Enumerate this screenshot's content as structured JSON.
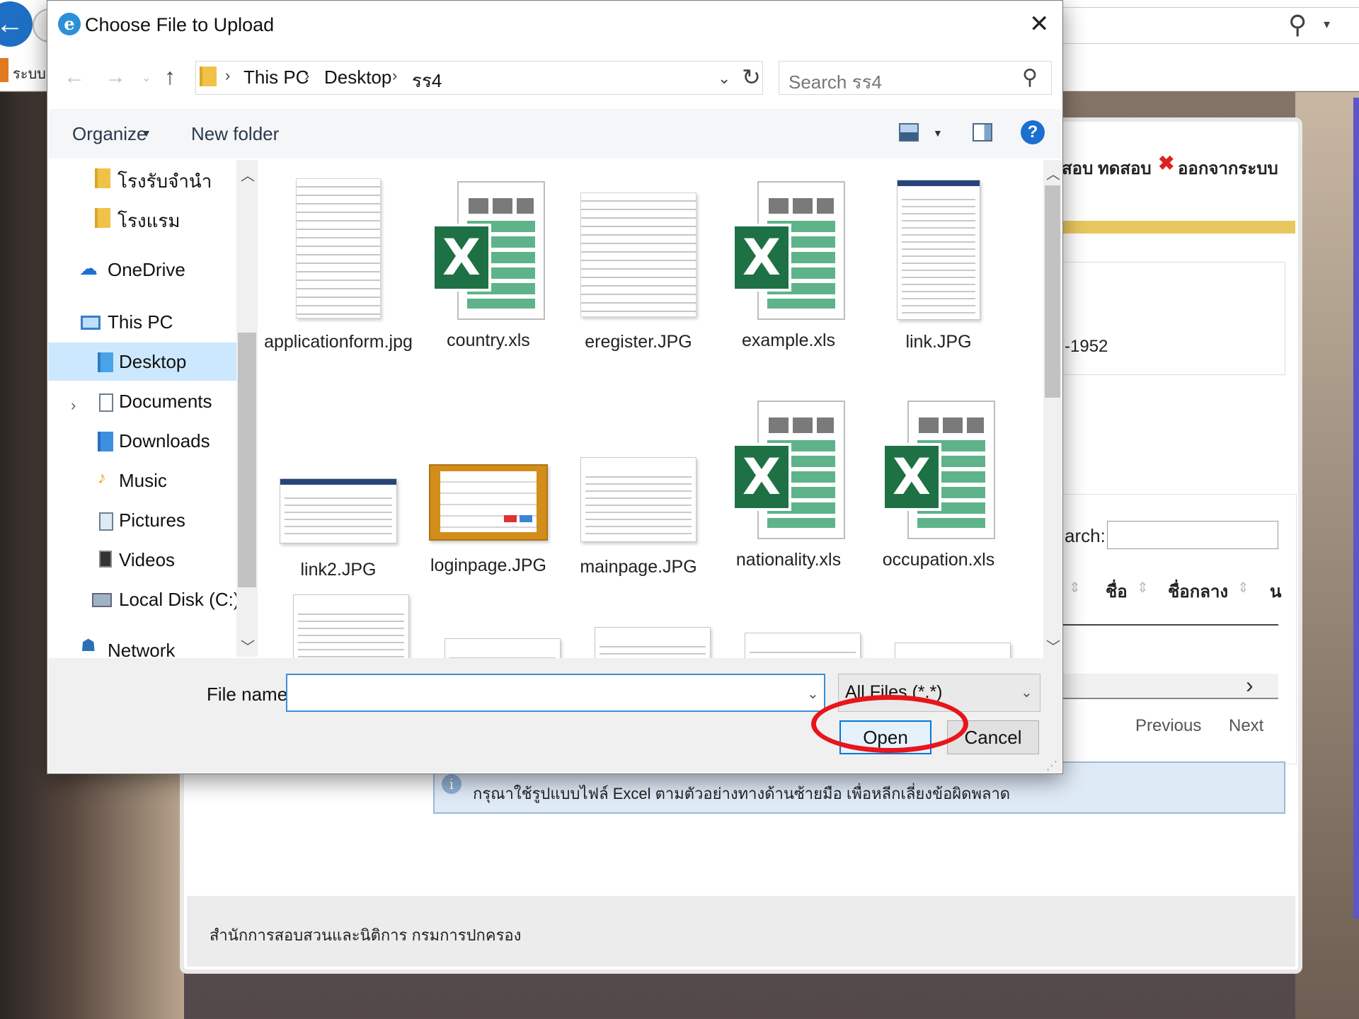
{
  "browser": {
    "tab_label": "ระบบ"
  },
  "dialog": {
    "title": "Choose File to Upload",
    "close_glyph": "✕",
    "nav": {
      "back": "←",
      "forward": "→",
      "recent": "⌄",
      "up": "↑"
    },
    "breadcrumb": [
      "This PC",
      "Desktop",
      "รร4"
    ],
    "breadcrumb_separator": "›",
    "search_placeholder": "Search รร4",
    "toolbar": {
      "organize": "Organize",
      "new_folder": "New folder",
      "help": "?"
    },
    "nav_pane": [
      {
        "label": "โรงรับจำนำ",
        "icon": "folder-icon"
      },
      {
        "label": "โรงแรม",
        "icon": "folder-icon"
      },
      {
        "label": "OneDrive",
        "icon": "cloud-icon"
      },
      {
        "label": "This PC",
        "icon": "computer-icon"
      },
      {
        "label": "Desktop",
        "icon": "desktop-folder-icon",
        "selected": true
      },
      {
        "label": "Documents",
        "icon": "documents-icon"
      },
      {
        "label": "Downloads",
        "icon": "downloads-icon"
      },
      {
        "label": "Music",
        "icon": "music-icon"
      },
      {
        "label": "Pictures",
        "icon": "pictures-icon"
      },
      {
        "label": "Videos",
        "icon": "videos-icon"
      },
      {
        "label": "Local Disk (C:)",
        "icon": "disk-icon"
      },
      {
        "label": "Network",
        "icon": "network-icon"
      }
    ],
    "files": [
      {
        "name": "applicationform.jpg",
        "kind": "image"
      },
      {
        "name": "country.xls",
        "kind": "excel"
      },
      {
        "name": "eregister.JPG",
        "kind": "image"
      },
      {
        "name": "example.xls",
        "kind": "excel"
      },
      {
        "name": "link.JPG",
        "kind": "image"
      },
      {
        "name": "link2.JPG",
        "kind": "image"
      },
      {
        "name": "loginpage.JPG",
        "kind": "image"
      },
      {
        "name": "mainpage.JPG",
        "kind": "image"
      },
      {
        "name": "nationality.xls",
        "kind": "excel"
      },
      {
        "name": "occupation.xls",
        "kind": "excel"
      }
    ],
    "filename_label": "File name:",
    "filename_value": "",
    "filter_value": "All Files (*.*)",
    "open_label": "Open",
    "cancel_label": "Cancel"
  },
  "webpage": {
    "header_text": "สอบ ทดสอบ",
    "logout_label": "ออกจากระบบ",
    "number_fragment": "-1952",
    "search_label": "arch:",
    "columns": [
      "ชื่อ",
      "ชื่อกลาง",
      "น"
    ],
    "previous_label": "Previous",
    "next_label": "Next",
    "notice_text": "กรุณาใช้รูปแบบไฟล์ Excel ตามตัวอย่างทางด้านซ้ายมือ เพื่อหลีกเลี่ยงข้อผิดพลาด",
    "footer_text": "สำนักการสอบสวนและนิติการ กรมการปกครอง"
  },
  "colors": {
    "accent": "#0078d7",
    "highlight_ring": "#e8151b",
    "selected_nav": "#cce8ff",
    "excel_green": "#1e7145"
  }
}
